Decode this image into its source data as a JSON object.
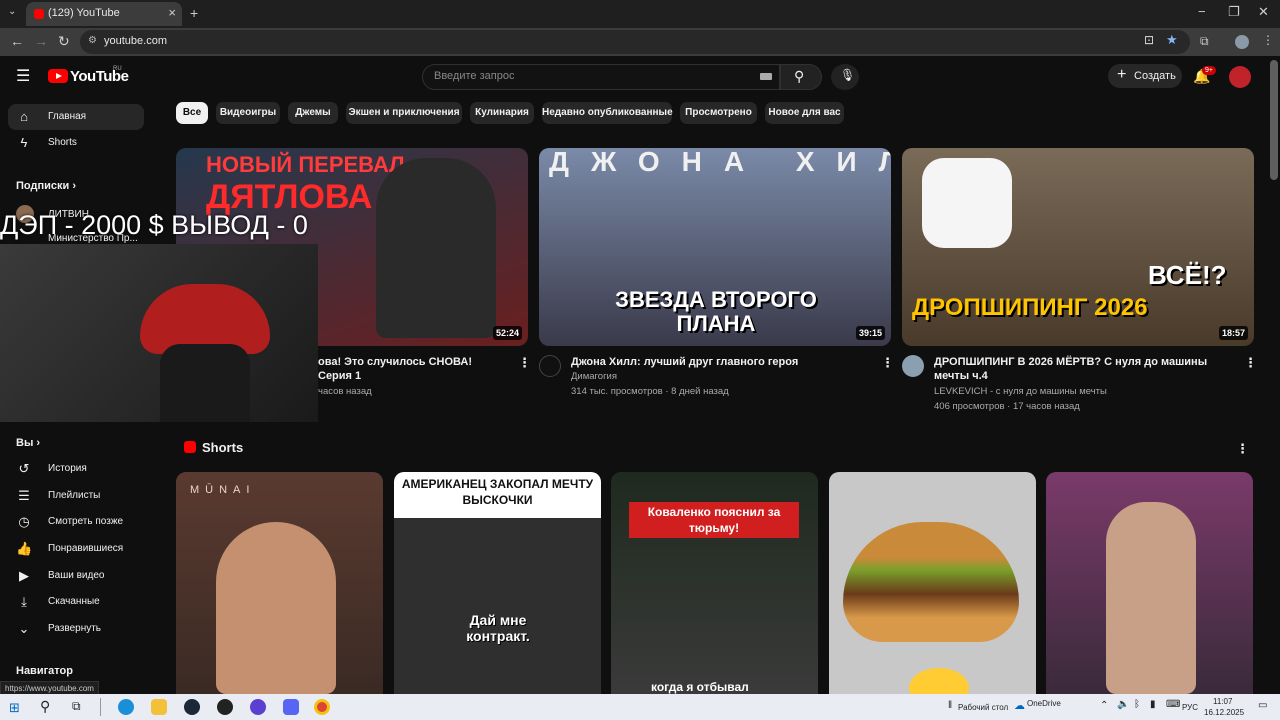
{
  "browser": {
    "tab_title": "(129) YouTube",
    "tab_close": "×",
    "new_tab": "+",
    "url": "youtube.com",
    "status_url": "https://www.youtube.com",
    "win_min": "−",
    "win_max": "❐",
    "win_close": "✕"
  },
  "header": {
    "logo_text": "YouTube",
    "logo_region": "RU",
    "search_placeholder": "Введите запрос",
    "create_label": "Создать",
    "notif_count": "9+"
  },
  "sidebar": {
    "main": [
      {
        "icon": "home-icon",
        "glyph": "⌂",
        "label": "Главная"
      },
      {
        "icon": "shorts-icon",
        "glyph": "ϟ",
        "label": "Shorts"
      }
    ],
    "subs_heading": "Подписки",
    "subs": [
      {
        "label": "ЛИТВИН"
      },
      {
        "label": "Министерство Пр..."
      }
    ],
    "you_heading": "Вы",
    "you": [
      {
        "icon": "history-icon",
        "glyph": "↺",
        "label": "История"
      },
      {
        "icon": "playlists-icon",
        "glyph": "☰",
        "label": "Плейлисты"
      },
      {
        "icon": "watch-later-icon",
        "glyph": "◷",
        "label": "Смотреть позже"
      },
      {
        "icon": "like-icon",
        "glyph": "👍",
        "label": "Понравившиеся"
      },
      {
        "icon": "your-videos-icon",
        "glyph": "▶",
        "label": "Ваши видео"
      },
      {
        "icon": "download-icon",
        "glyph": "⤓",
        "label": "Скачанные"
      },
      {
        "icon": "expand-icon",
        "glyph": "⌄",
        "label": "Развернуть"
      }
    ],
    "nav_heading": "Навигатор"
  },
  "chips": [
    "Все",
    "Видеоигры",
    "Джемы",
    "Экшен и приключения",
    "Кулинария",
    "Недавно опубликованные",
    "Просмотрено",
    "Новое для вас"
  ],
  "videos": [
    {
      "thumb_text_top": "НОВЫЙ ПЕРЕВАЛ",
      "thumb_text_big": "ДЯТЛОВА",
      "duration": "52:24",
      "title": "ова! Это случилось СНОВА! Серия 1",
      "channel": "",
      "meta": "часов назад",
      "bg": "#3a4a5c"
    },
    {
      "thumb_text_top": "ДЖОНА ХИЛЛ",
      "thumb_text_big": "ЗВЕЗДА ВТОРОГО ПЛАНА",
      "duration": "39:15",
      "title": "Джона Хилл: лучший друг главного героя",
      "channel": "Димагогия",
      "meta": "314 тыс. просмотров · 8 дней назад",
      "bg": "#5b6a8a"
    },
    {
      "thumb_text_top": "ВСЁ!?",
      "thumb_text_big": "ДРОПШИПИНГ 2026",
      "duration": "18:57",
      "title": "ДРОПШИПИНГ В 2026 МЁРТВ? С нуля до машины мечты ч.4",
      "channel": "LEVKEVICH - с нуля до машины мечты",
      "meta": "406 просмотров · 17 часов назад",
      "bg": "#6a5a48"
    }
  ],
  "shorts_heading": "Shorts",
  "shorts": [
    {
      "caption": "MŪNAI",
      "bg": "#5a3a30"
    },
    {
      "caption": "АМЕРИКАНЕЦ ЗАКОПАЛ МЕЧТУ ВЫСКОЧКИ",
      "sub": "Дай мне контракт.",
      "bg": "#3a3a3a"
    },
    {
      "caption": "Коваленко пояснил за тюрьму!",
      "sub": "когда я отбывал",
      "bg": "#2a2a2a"
    },
    {
      "caption": "",
      "bg": "#c8c8c8"
    },
    {
      "caption": "",
      "bg": "#6a3a5a"
    }
  ],
  "cam_text": "ДЭП - 2000 $ ВЫВОД - 0",
  "taskbar": {
    "desktop": "Рабочий стол",
    "onedrive": "OneDrive",
    "lang": "РУС",
    "time": "11:07",
    "date": "16.12.2025"
  }
}
